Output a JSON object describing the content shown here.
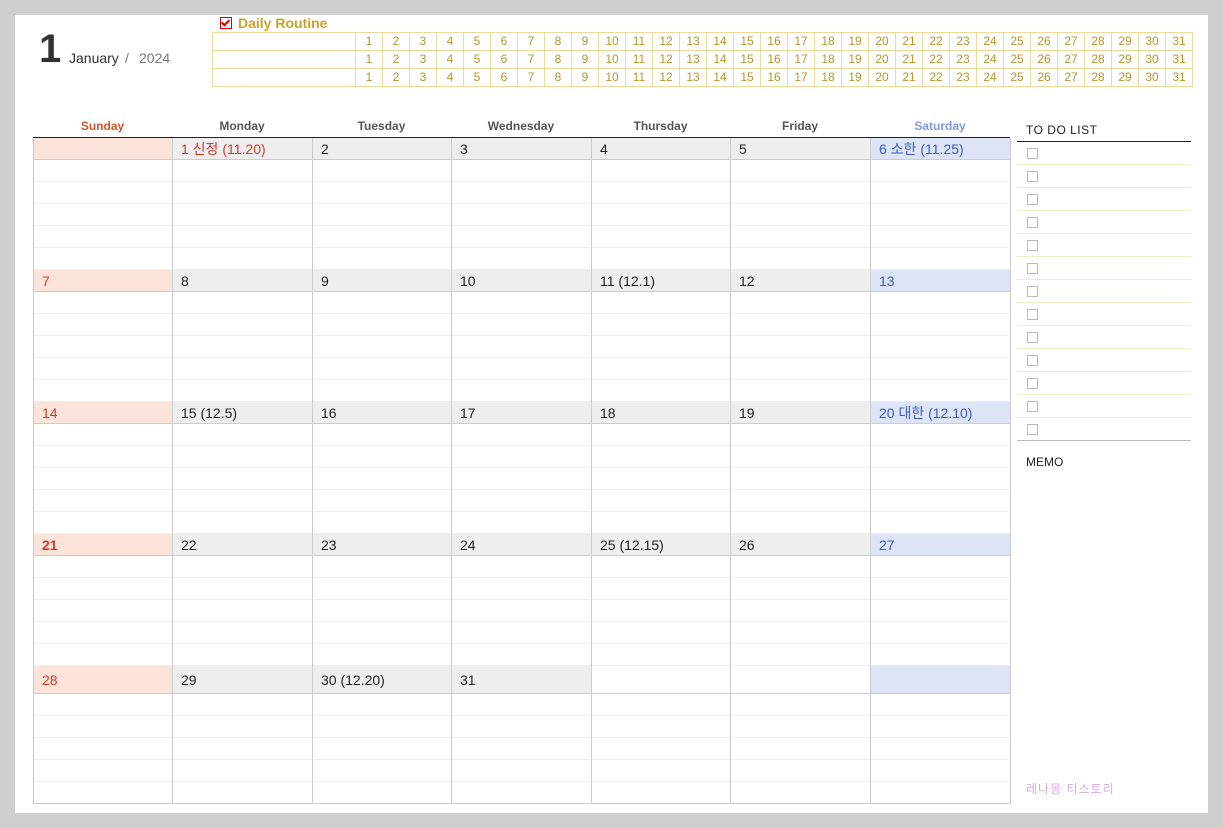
{
  "header": {
    "month_number": "1",
    "month_name": "January",
    "separator": "/",
    "year": "2024"
  },
  "routine": {
    "title": "Daily Routine",
    "rows": [
      [
        "1",
        "2",
        "3",
        "4",
        "5",
        "6",
        "7",
        "8",
        "9",
        "10",
        "11",
        "12",
        "13",
        "14",
        "15",
        "16",
        "17",
        "18",
        "19",
        "20",
        "21",
        "22",
        "23",
        "24",
        "25",
        "26",
        "27",
        "28",
        "29",
        "30",
        "31"
      ],
      [
        "1",
        "2",
        "3",
        "4",
        "5",
        "6",
        "7",
        "8",
        "9",
        "10",
        "11",
        "12",
        "13",
        "14",
        "15",
        "16",
        "17",
        "18",
        "19",
        "20",
        "21",
        "22",
        "23",
        "24",
        "25",
        "26",
        "27",
        "28",
        "29",
        "30",
        "31"
      ],
      [
        "1",
        "2",
        "3",
        "4",
        "5",
        "6",
        "7",
        "8",
        "9",
        "10",
        "11",
        "12",
        "13",
        "14",
        "15",
        "16",
        "17",
        "18",
        "19",
        "20",
        "21",
        "22",
        "23",
        "24",
        "25",
        "26",
        "27",
        "28",
        "29",
        "30",
        "31"
      ]
    ]
  },
  "calendar": {
    "weekdays": [
      "Sunday",
      "Monday",
      "Tuesday",
      "Wednesday",
      "Thursday",
      "Friday",
      "Saturday"
    ],
    "weeks": [
      [
        "",
        "1  신정  (11.20)",
        "2",
        "3",
        "4",
        "5",
        "6  소한  (11.25)"
      ],
      [
        "7",
        "8",
        "9",
        "10",
        "11  (12.1)",
        "12",
        "13"
      ],
      [
        "14",
        "15  (12.5)",
        "16",
        "17",
        "18",
        "19",
        "20  대한  (12.10)"
      ],
      [
        "21",
        "22",
        "23",
        "24",
        "25  (12.15)",
        "26",
        "27"
      ],
      [
        "28",
        "29",
        "30  (12.20)",
        "31",
        "",
        "",
        ""
      ]
    ]
  },
  "todo": {
    "title": "TO  DO  LIST",
    "item_count": 13
  },
  "memo": {
    "title": "MEMO"
  },
  "watermark": "레나몽 티스토리"
}
